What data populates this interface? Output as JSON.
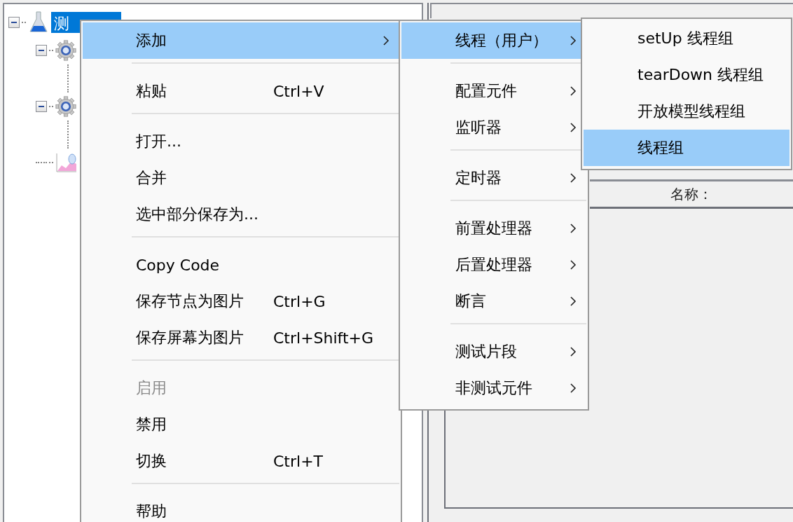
{
  "tree": {
    "label": "测",
    "selected": true,
    "expanded": true,
    "kind": "plan",
    "children": [
      {
        "kind": "thread-group",
        "expanded": true
      },
      {
        "kind": "thread-group",
        "expanded": true
      },
      {
        "kind": "listener"
      }
    ]
  },
  "details": {
    "name_label": "名称："
  },
  "context_menu": {
    "groups": [
      [
        {
          "label": "添加",
          "has_submenu": true,
          "selected": true,
          "disabled": false
        }
      ],
      [
        {
          "label": "粘贴",
          "shortcut": "Ctrl+V",
          "has_submenu": false,
          "selected": false,
          "disabled": false
        }
      ],
      [
        {
          "label": "打开...",
          "has_submenu": false,
          "selected": false,
          "disabled": false
        },
        {
          "label": "合并",
          "has_submenu": false,
          "selected": false,
          "disabled": false
        },
        {
          "label": "选中部分保存为...",
          "has_submenu": false,
          "selected": false,
          "disabled": false
        }
      ],
      [
        {
          "label": "Copy Code",
          "has_submenu": false,
          "selected": false,
          "disabled": false
        },
        {
          "label": "保存节点为图片",
          "shortcut": "Ctrl+G",
          "has_submenu": false,
          "selected": false,
          "disabled": false
        },
        {
          "label": "保存屏幕为图片",
          "shortcut": "Ctrl+Shift+G",
          "has_submenu": false,
          "selected": false,
          "disabled": false
        }
      ],
      [
        {
          "label": "启用",
          "has_submenu": false,
          "selected": false,
          "disabled": true
        },
        {
          "label": "禁用",
          "has_submenu": false,
          "selected": false,
          "disabled": false
        },
        {
          "label": "切换",
          "shortcut": "Ctrl+T",
          "has_submenu": false,
          "selected": false,
          "disabled": false
        }
      ],
      [
        {
          "label": "帮助",
          "has_submenu": false,
          "selected": false,
          "disabled": false
        }
      ]
    ]
  },
  "add_submenu": {
    "groups": [
      [
        {
          "label": "线程（用户）",
          "has_submenu": true,
          "selected": true,
          "disabled": false
        }
      ],
      [
        {
          "label": "配置元件",
          "has_submenu": true,
          "selected": false,
          "disabled": false
        },
        {
          "label": "监听器",
          "has_submenu": true,
          "selected": false,
          "disabled": false
        }
      ],
      [
        {
          "label": "定时器",
          "has_submenu": true,
          "selected": false,
          "disabled": false
        }
      ],
      [
        {
          "label": "前置处理器",
          "has_submenu": true,
          "selected": false,
          "disabled": false
        },
        {
          "label": "后置处理器",
          "has_submenu": true,
          "selected": false,
          "disabled": false
        },
        {
          "label": "断言",
          "has_submenu": true,
          "selected": false,
          "disabled": false
        }
      ],
      [
        {
          "label": "测试片段",
          "has_submenu": true,
          "selected": false,
          "disabled": false
        },
        {
          "label": "非测试元件",
          "has_submenu": true,
          "selected": false,
          "disabled": false
        }
      ]
    ]
  },
  "threads_submenu": {
    "groups": [
      [
        {
          "label": "setUp 线程组",
          "selected": false,
          "disabled": false
        },
        {
          "label": "tearDown 线程组",
          "selected": false,
          "disabled": false
        },
        {
          "label": "开放模型线程组",
          "selected": false,
          "disabled": false
        },
        {
          "label": "线程组",
          "selected": true,
          "disabled": false
        }
      ]
    ]
  }
}
